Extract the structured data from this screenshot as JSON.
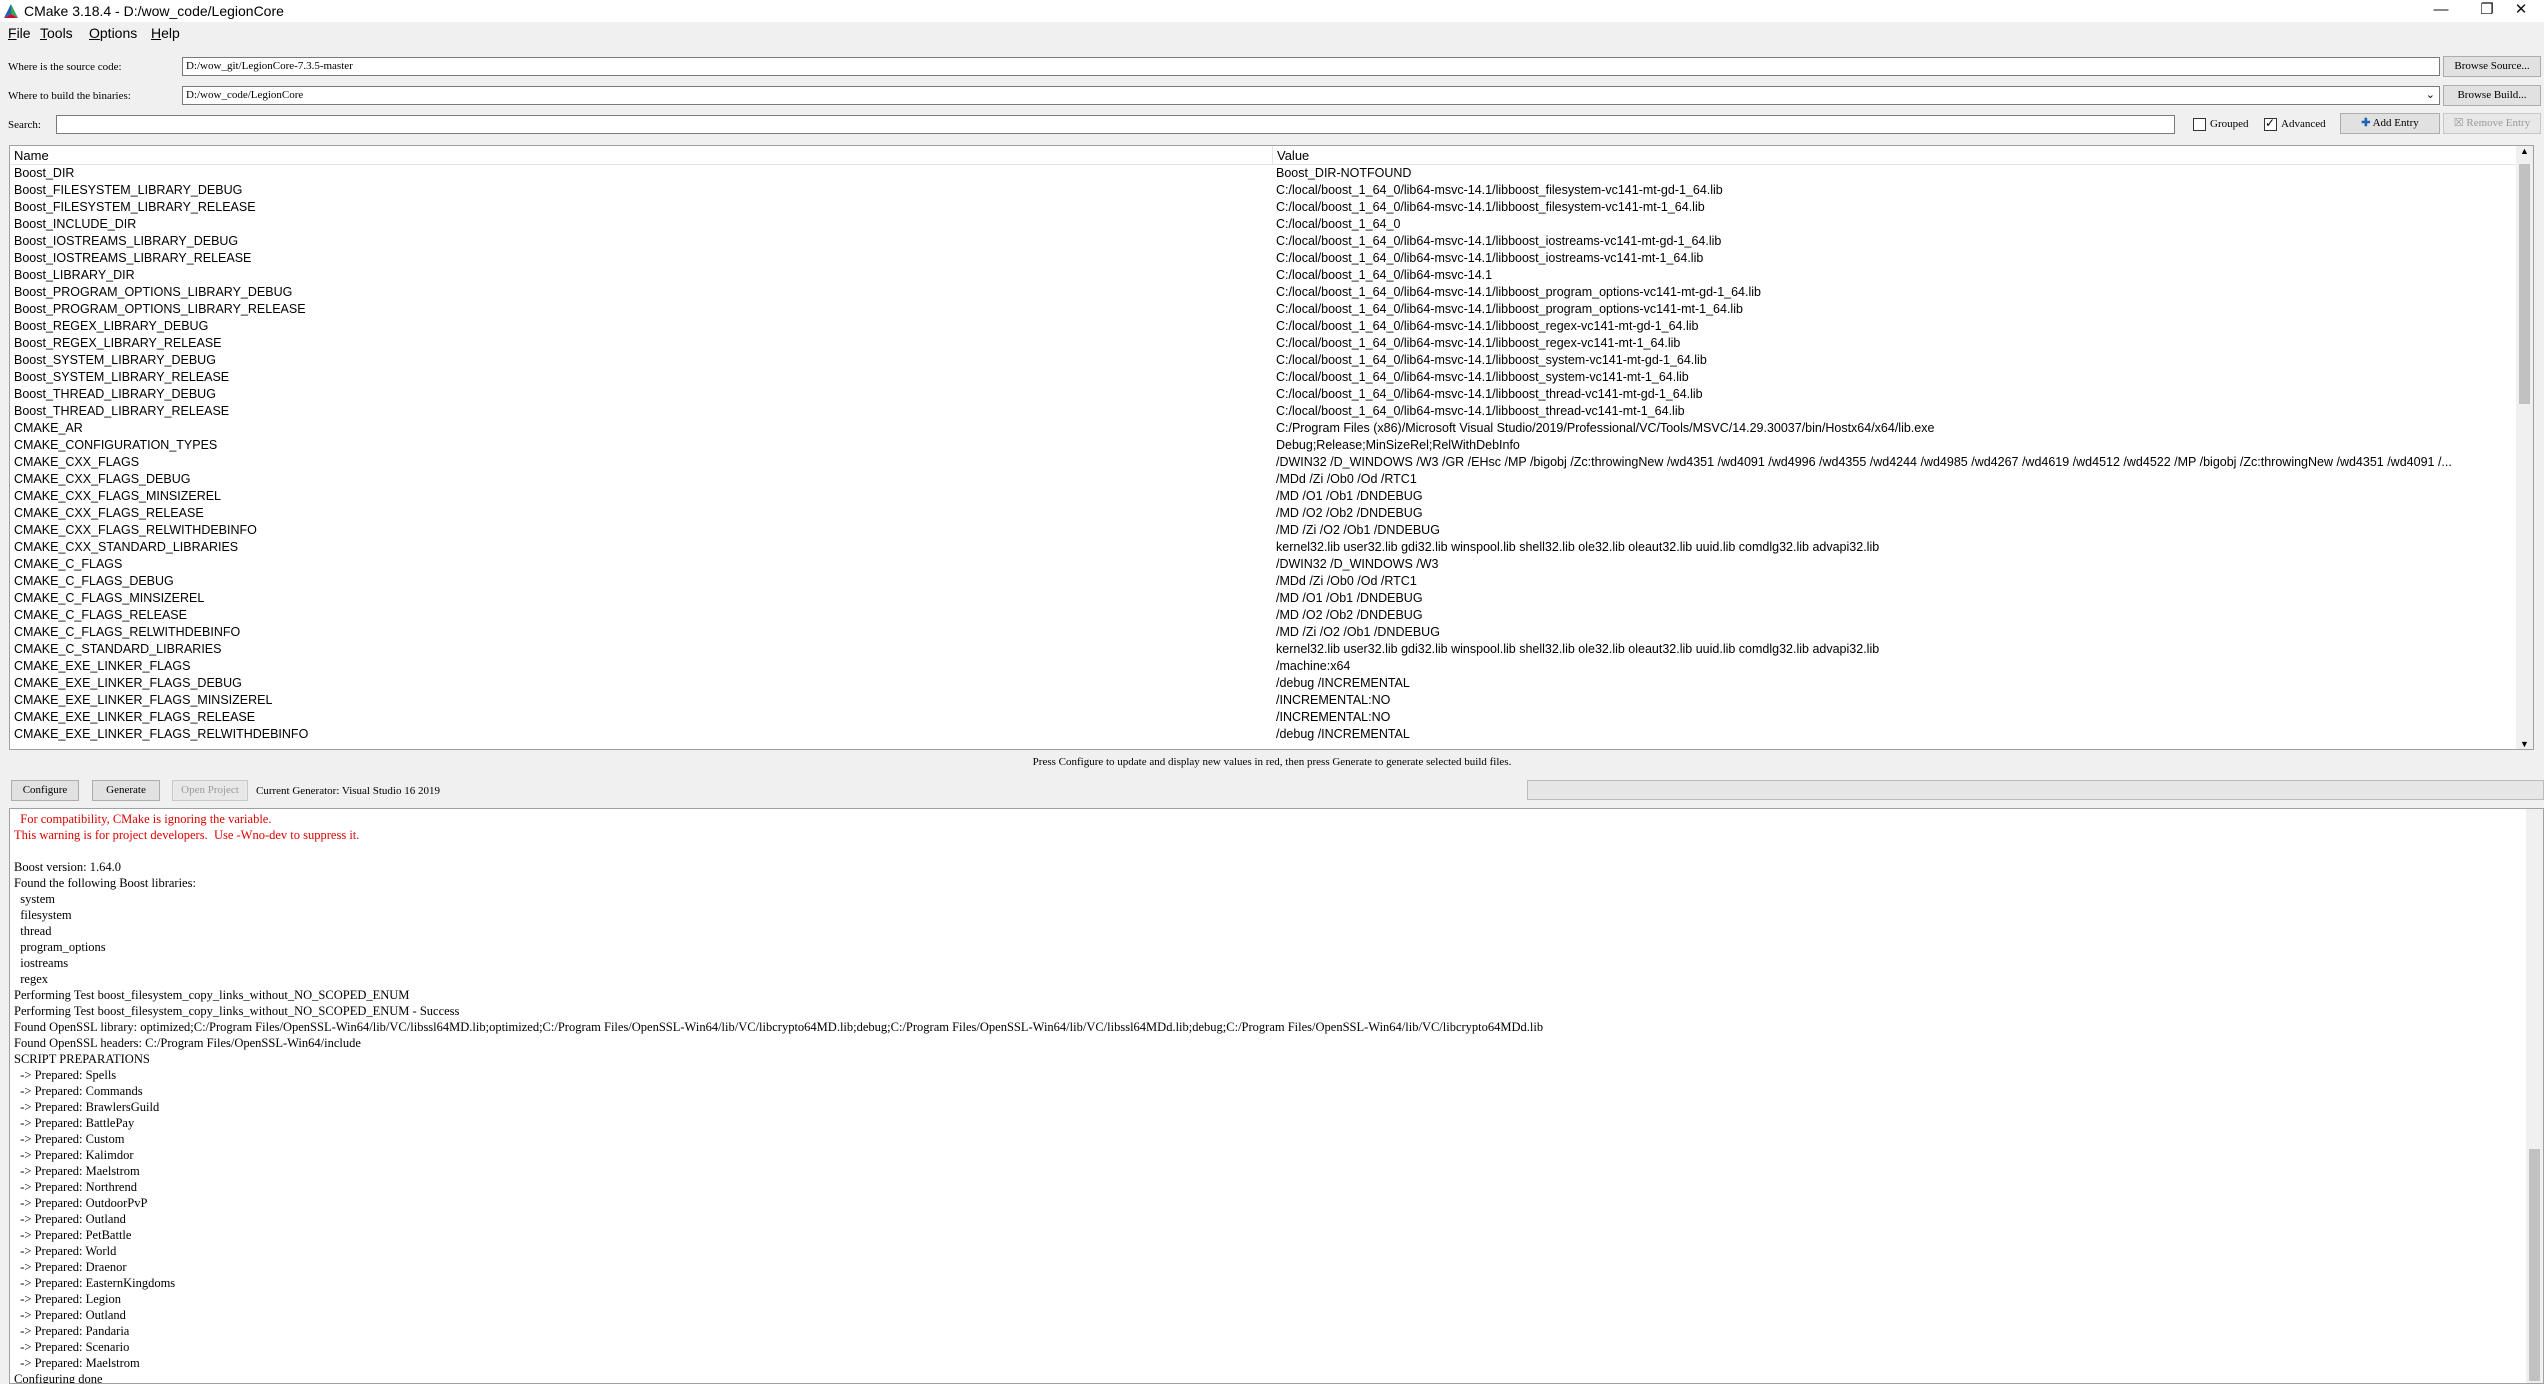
{
  "window": {
    "title": "CMake 3.18.4 - D:/wow_code/LegionCore",
    "minimize_glyph": "—",
    "maximize_glyph": "❐",
    "close_glyph": "✕"
  },
  "menu": [
    {
      "label": "File",
      "accel": "F",
      "rest": "ile"
    },
    {
      "label": "Tools",
      "accel": "T",
      "rest": "ools"
    },
    {
      "label": "Options",
      "accel": "O",
      "rest": "ptions"
    },
    {
      "label": "Help",
      "accel": "H",
      "rest": "elp"
    }
  ],
  "source": {
    "label": "Where is the source code:",
    "value": "D:/wow_git/LegionCore-7.3.5-master",
    "browse": "Browse Source..."
  },
  "build": {
    "label": "Where to build the binaries:",
    "value": "D:/wow_code/LegionCore",
    "browse": "Browse Build..."
  },
  "search": {
    "label": "Search:",
    "value": ""
  },
  "options": {
    "grouped_label": "Grouped",
    "grouped": false,
    "advanced_label": "Advanced",
    "advanced": true,
    "add_entry": "Add Entry",
    "remove_entry": "Remove Entry"
  },
  "table": {
    "col_name": "Name",
    "col_value": "Value",
    "rows": [
      {
        "name": "Boost_DIR",
        "value": "Boost_DIR-NOTFOUND"
      },
      {
        "name": "Boost_FILESYSTEM_LIBRARY_DEBUG",
        "value": "C:/local/boost_1_64_0/lib64-msvc-14.1/libboost_filesystem-vc141-mt-gd-1_64.lib"
      },
      {
        "name": "Boost_FILESYSTEM_LIBRARY_RELEASE",
        "value": "C:/local/boost_1_64_0/lib64-msvc-14.1/libboost_filesystem-vc141-mt-1_64.lib"
      },
      {
        "name": "Boost_INCLUDE_DIR",
        "value": "C:/local/boost_1_64_0"
      },
      {
        "name": "Boost_IOSTREAMS_LIBRARY_DEBUG",
        "value": "C:/local/boost_1_64_0/lib64-msvc-14.1/libboost_iostreams-vc141-mt-gd-1_64.lib"
      },
      {
        "name": "Boost_IOSTREAMS_LIBRARY_RELEASE",
        "value": "C:/local/boost_1_64_0/lib64-msvc-14.1/libboost_iostreams-vc141-mt-1_64.lib"
      },
      {
        "name": "Boost_LIBRARY_DIR",
        "value": "C:/local/boost_1_64_0/lib64-msvc-14.1"
      },
      {
        "name": "Boost_PROGRAM_OPTIONS_LIBRARY_DEBUG",
        "value": "C:/local/boost_1_64_0/lib64-msvc-14.1/libboost_program_options-vc141-mt-gd-1_64.lib"
      },
      {
        "name": "Boost_PROGRAM_OPTIONS_LIBRARY_RELEASE",
        "value": "C:/local/boost_1_64_0/lib64-msvc-14.1/libboost_program_options-vc141-mt-1_64.lib"
      },
      {
        "name": "Boost_REGEX_LIBRARY_DEBUG",
        "value": "C:/local/boost_1_64_0/lib64-msvc-14.1/libboost_regex-vc141-mt-gd-1_64.lib"
      },
      {
        "name": "Boost_REGEX_LIBRARY_RELEASE",
        "value": "C:/local/boost_1_64_0/lib64-msvc-14.1/libboost_regex-vc141-mt-1_64.lib"
      },
      {
        "name": "Boost_SYSTEM_LIBRARY_DEBUG",
        "value": "C:/local/boost_1_64_0/lib64-msvc-14.1/libboost_system-vc141-mt-gd-1_64.lib"
      },
      {
        "name": "Boost_SYSTEM_LIBRARY_RELEASE",
        "value": "C:/local/boost_1_64_0/lib64-msvc-14.1/libboost_system-vc141-mt-1_64.lib"
      },
      {
        "name": "Boost_THREAD_LIBRARY_DEBUG",
        "value": "C:/local/boost_1_64_0/lib64-msvc-14.1/libboost_thread-vc141-mt-gd-1_64.lib"
      },
      {
        "name": "Boost_THREAD_LIBRARY_RELEASE",
        "value": "C:/local/boost_1_64_0/lib64-msvc-14.1/libboost_thread-vc141-mt-1_64.lib"
      },
      {
        "name": "CMAKE_AR",
        "value": "C:/Program Files (x86)/Microsoft Visual Studio/2019/Professional/VC/Tools/MSVC/14.29.30037/bin/Hostx64/x64/lib.exe"
      },
      {
        "name": "CMAKE_CONFIGURATION_TYPES",
        "value": "Debug;Release;MinSizeRel;RelWithDebInfo"
      },
      {
        "name": "CMAKE_CXX_FLAGS",
        "value": "/DWIN32 /D_WINDOWS /W3 /GR /EHsc /MP /bigobj /Zc:throwingNew /wd4351 /wd4091 /wd4996 /wd4355 /wd4244 /wd4985 /wd4267 /wd4619 /wd4512 /wd4522 /MP /bigobj /Zc:throwingNew /wd4351 /wd4091 /..."
      },
      {
        "name": "CMAKE_CXX_FLAGS_DEBUG",
        "value": "/MDd /Zi /Ob0 /Od /RTC1"
      },
      {
        "name": "CMAKE_CXX_FLAGS_MINSIZEREL",
        "value": "/MD /O1 /Ob1 /DNDEBUG"
      },
      {
        "name": "CMAKE_CXX_FLAGS_RELEASE",
        "value": "/MD /O2 /Ob2 /DNDEBUG"
      },
      {
        "name": "CMAKE_CXX_FLAGS_RELWITHDEBINFO",
        "value": "/MD /Zi /O2 /Ob1 /DNDEBUG"
      },
      {
        "name": "CMAKE_CXX_STANDARD_LIBRARIES",
        "value": "kernel32.lib user32.lib gdi32.lib winspool.lib shell32.lib ole32.lib oleaut32.lib uuid.lib comdlg32.lib advapi32.lib"
      },
      {
        "name": "CMAKE_C_FLAGS",
        "value": "/DWIN32 /D_WINDOWS /W3"
      },
      {
        "name": "CMAKE_C_FLAGS_DEBUG",
        "value": "/MDd /Zi /Ob0 /Od /RTC1"
      },
      {
        "name": "CMAKE_C_FLAGS_MINSIZEREL",
        "value": "/MD /O1 /Ob1 /DNDEBUG"
      },
      {
        "name": "CMAKE_C_FLAGS_RELEASE",
        "value": "/MD /O2 /Ob2 /DNDEBUG"
      },
      {
        "name": "CMAKE_C_FLAGS_RELWITHDEBINFO",
        "value": "/MD /Zi /O2 /Ob1 /DNDEBUG"
      },
      {
        "name": "CMAKE_C_STANDARD_LIBRARIES",
        "value": "kernel32.lib user32.lib gdi32.lib winspool.lib shell32.lib ole32.lib oleaut32.lib uuid.lib comdlg32.lib advapi32.lib"
      },
      {
        "name": "CMAKE_EXE_LINKER_FLAGS",
        "value": "/machine:x64"
      },
      {
        "name": "CMAKE_EXE_LINKER_FLAGS_DEBUG",
        "value": "/debug /INCREMENTAL"
      },
      {
        "name": "CMAKE_EXE_LINKER_FLAGS_MINSIZEREL",
        "value": "/INCREMENTAL:NO"
      },
      {
        "name": "CMAKE_EXE_LINKER_FLAGS_RELEASE",
        "value": "/INCREMENTAL:NO"
      },
      {
        "name": "CMAKE_EXE_LINKER_FLAGS_RELWITHDEBINFO",
        "value": "/debug /INCREMENTAL"
      }
    ]
  },
  "status_message": "Press Configure to update and display new values in red, then press Generate to generate selected build files.",
  "actions": {
    "configure": "Configure",
    "generate": "Generate",
    "open_project": "Open Project",
    "generator": "Current Generator: Visual Studio 16 2019"
  },
  "output": [
    {
      "text": "  For compatibility, CMake is ignoring the variable.",
      "warn": true
    },
    {
      "text": "This warning is for project developers.  Use -Wno-dev to suppress it.",
      "warn": true
    },
    {
      "text": "",
      "warn": false
    },
    {
      "text": "Boost version: 1.64.0",
      "warn": false
    },
    {
      "text": "Found the following Boost libraries:",
      "warn": false
    },
    {
      "text": "  system",
      "warn": false
    },
    {
      "text": "  filesystem",
      "warn": false
    },
    {
      "text": "  thread",
      "warn": false
    },
    {
      "text": "  program_options",
      "warn": false
    },
    {
      "text": "  iostreams",
      "warn": false
    },
    {
      "text": "  regex",
      "warn": false
    },
    {
      "text": "Performing Test boost_filesystem_copy_links_without_NO_SCOPED_ENUM",
      "warn": false
    },
    {
      "text": "Performing Test boost_filesystem_copy_links_without_NO_SCOPED_ENUM - Success",
      "warn": false
    },
    {
      "text": "Found OpenSSL library: optimized;C:/Program Files/OpenSSL-Win64/lib/VC/libssl64MD.lib;optimized;C:/Program Files/OpenSSL-Win64/lib/VC/libcrypto64MD.lib;debug;C:/Program Files/OpenSSL-Win64/lib/VC/libssl64MDd.lib;debug;C:/Program Files/OpenSSL-Win64/lib/VC/libcrypto64MDd.lib",
      "warn": false
    },
    {
      "text": "Found OpenSSL headers: C:/Program Files/OpenSSL-Win64/include",
      "warn": false
    },
    {
      "text": "SCRIPT PREPARATIONS",
      "warn": false
    },
    {
      "text": "  -> Prepared: Spells",
      "warn": false
    },
    {
      "text": "  -> Prepared: Commands",
      "warn": false
    },
    {
      "text": "  -> Prepared: BrawlersGuild",
      "warn": false
    },
    {
      "text": "  -> Prepared: BattlePay",
      "warn": false
    },
    {
      "text": "  -> Prepared: Custom",
      "warn": false
    },
    {
      "text": "  -> Prepared: Kalimdor",
      "warn": false
    },
    {
      "text": "  -> Prepared: Maelstrom",
      "warn": false
    },
    {
      "text": "  -> Prepared: Northrend",
      "warn": false
    },
    {
      "text": "  -> Prepared: OutdoorPvP",
      "warn": false
    },
    {
      "text": "  -> Prepared: Outland",
      "warn": false
    },
    {
      "text": "  -> Prepared: PetBattle",
      "warn": false
    },
    {
      "text": "  -> Prepared: World",
      "warn": false
    },
    {
      "text": "  -> Prepared: Draenor",
      "warn": false
    },
    {
      "text": "  -> Prepared: EasternKingdoms",
      "warn": false
    },
    {
      "text": "  -> Prepared: Legion",
      "warn": false
    },
    {
      "text": "  -> Prepared: Outland",
      "warn": false
    },
    {
      "text": "  -> Prepared: Pandaria",
      "warn": false
    },
    {
      "text": "  -> Prepared: Scenario",
      "warn": false
    },
    {
      "text": "  -> Prepared: Maelstrom",
      "warn": false
    },
    {
      "text": "Configuring done",
      "warn": false
    }
  ],
  "colors": {
    "warning": "#e00000",
    "cmake_red": "#c8102e",
    "cmake_blue": "#1f63b8",
    "cmake_green": "#3aa655"
  }
}
